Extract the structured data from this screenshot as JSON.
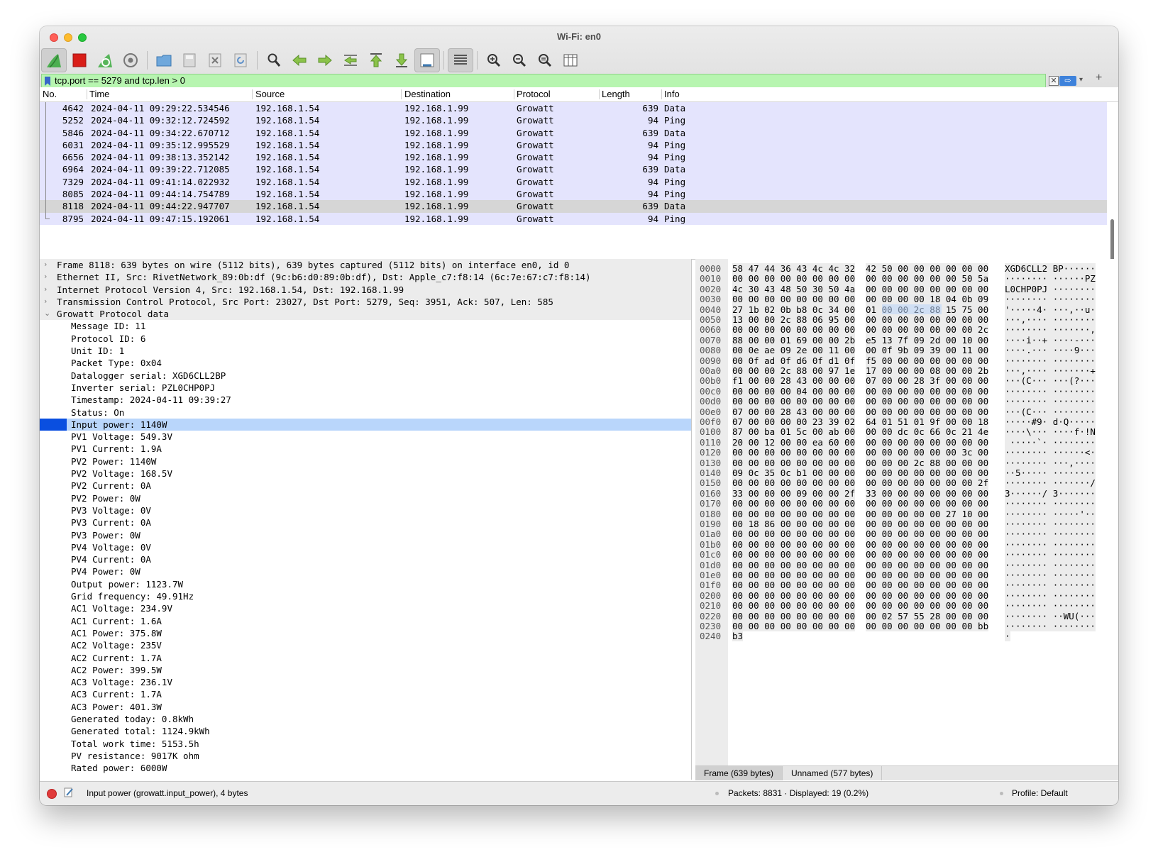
{
  "window": {
    "title": "Wi-Fi: en0"
  },
  "toolbar": {
    "icons": [
      "shark-fin-start-icon",
      "stop-capture-icon",
      "restart-capture-icon",
      "capture-options-icon",
      "open-file-icon",
      "save-file-icon",
      "close-file-icon",
      "reload-icon",
      "find-packet-icon",
      "go-back-icon",
      "go-forward-icon",
      "go-to-packet-icon",
      "first-packet-icon",
      "last-packet-icon",
      "autoscroll-icon",
      "colorize-icon",
      "zoom-in-icon",
      "zoom-out-icon",
      "normal-size-icon",
      "resize-columns-icon"
    ]
  },
  "filter": {
    "value": "tcp.port == 5279 and tcp.len > 0",
    "clear": "✕",
    "apply": "⇨",
    "dropdown": "▾",
    "add": "+"
  },
  "packet_list": {
    "columns": [
      "No.",
      "Time",
      "Source",
      "Destination",
      "Protocol",
      "Length",
      "Info"
    ],
    "rows": [
      {
        "no": "4642",
        "time": "2024-04-11 09:29:22.534546",
        "src": "192.168.1.54",
        "dst": "192.168.1.99",
        "proto": "Growatt",
        "len": "639",
        "info": "Data"
      },
      {
        "no": "5252",
        "time": "2024-04-11 09:32:12.724592",
        "src": "192.168.1.54",
        "dst": "192.168.1.99",
        "proto": "Growatt",
        "len": "94",
        "info": "Ping"
      },
      {
        "no": "5846",
        "time": "2024-04-11 09:34:22.670712",
        "src": "192.168.1.54",
        "dst": "192.168.1.99",
        "proto": "Growatt",
        "len": "639",
        "info": "Data"
      },
      {
        "no": "6031",
        "time": "2024-04-11 09:35:12.995529",
        "src": "192.168.1.54",
        "dst": "192.168.1.99",
        "proto": "Growatt",
        "len": "94",
        "info": "Ping"
      },
      {
        "no": "6656",
        "time": "2024-04-11 09:38:13.352142",
        "src": "192.168.1.54",
        "dst": "192.168.1.99",
        "proto": "Growatt",
        "len": "94",
        "info": "Ping"
      },
      {
        "no": "6964",
        "time": "2024-04-11 09:39:22.712085",
        "src": "192.168.1.54",
        "dst": "192.168.1.99",
        "proto": "Growatt",
        "len": "639",
        "info": "Data"
      },
      {
        "no": "7329",
        "time": "2024-04-11 09:41:14.022932",
        "src": "192.168.1.54",
        "dst": "192.168.1.99",
        "proto": "Growatt",
        "len": "94",
        "info": "Ping"
      },
      {
        "no": "8085",
        "time": "2024-04-11 09:44:14.754789",
        "src": "192.168.1.54",
        "dst": "192.168.1.99",
        "proto": "Growatt",
        "len": "94",
        "info": "Ping"
      },
      {
        "no": "8118",
        "time": "2024-04-11 09:44:22.947707",
        "src": "192.168.1.54",
        "dst": "192.168.1.99",
        "proto": "Growatt",
        "len": "639",
        "info": "Data"
      },
      {
        "no": "8795",
        "time": "2024-04-11 09:47:15.192061",
        "src": "192.168.1.54",
        "dst": "192.168.1.99",
        "proto": "Growatt",
        "len": "94",
        "info": "Ping"
      }
    ],
    "selected_index": 8
  },
  "details": {
    "top": [
      {
        "text": "Frame 8118: 639 bytes on wire (5112 bits), 639 bytes captured (5112 bits) on interface en0, id 0",
        "arrow": "›"
      },
      {
        "text": "Ethernet II, Src: RivetNetwork_89:0b:df (9c:b6:d0:89:0b:df), Dst: Apple_c7:f8:14 (6c:7e:67:c7:f8:14)",
        "arrow": "›"
      },
      {
        "text": "Internet Protocol Version 4, Src: 192.168.1.54, Dst: 192.168.1.99",
        "arrow": "›"
      },
      {
        "text": "Transmission Control Protocol, Src Port: 23027, Dst Port: 5279, Seq: 3951, Ack: 507, Len: 585",
        "arrow": "›"
      },
      {
        "text": "Growatt Protocol data",
        "arrow": "⌄"
      }
    ],
    "fields": [
      "Message ID: 11",
      "Protocol ID: 6",
      "Unit ID: 1",
      "Packet Type: 0x04",
      "Datalogger serial: XGD6CLL2BP",
      "Inverter serial: PZL0CHP0PJ",
      "Timestamp: 2024-04-11 09:39:27",
      "Status: On",
      "Input power: 1140W",
      "PV1 Voltage: 549.3V",
      "PV1 Current: 1.9A",
      "PV2 Power: 1140W",
      "PV2 Voltage: 168.5V",
      "PV2 Current: 0A",
      "PV2 Power: 0W",
      "PV3 Voltage: 0V",
      "PV3 Current: 0A",
      "PV3 Power: 0W",
      "PV4 Voltage: 0V",
      "PV4 Current: 0A",
      "PV4 Power: 0W",
      "Output power: 1123.7W",
      "Grid frequency: 49.91Hz",
      "AC1 Voltage: 234.9V",
      "AC1 Current: 1.6A",
      "AC1 Power: 375.8W",
      "AC2 Voltage: 235V",
      "AC2 Current: 1.7A",
      "AC2 Power: 399.5W",
      "AC3 Voltage: 236.1V",
      "AC3 Current: 1.7A",
      "AC3 Power: 401.3W",
      "Generated today: 0.8kWh",
      "Generated total: 1124.9kWh",
      "Total work time: 5153.5h",
      "PV resistance: 9017K ohm",
      "Rated power: 6000W"
    ],
    "highlighted_index": 8
  },
  "hex": {
    "rows": [
      {
        "off": "0000",
        "b1": "58 47 44 36 43 4c 4c 32",
        "b2": "42 50 00 00 00 00 00 00",
        "asc": "XGD6CLL2 BP······"
      },
      {
        "off": "0010",
        "b1": "00 00 00 00 00 00 00 00",
        "b2": "00 00 00 00 00 00 50 5a",
        "asc": "········ ······PZ"
      },
      {
        "off": "0020",
        "b1": "4c 30 43 48 50 30 50 4a",
        "b2": "00 00 00 00 00 00 00 00",
        "asc": "L0CHP0PJ ········"
      },
      {
        "off": "0030",
        "b1": "00 00 00 00 00 00 00 00",
        "b2": "00 00 00 00 18 04 0b 09",
        "asc": "········ ········"
      },
      {
        "off": "0040",
        "b1": "27 1b 02 0b b8 0c 34 00",
        "b2": "01 00 00 2c 88 15 75 00",
        "asc": "'·····4· ···,··u·",
        "hl": true
      },
      {
        "off": "0050",
        "b1": "13 00 00 2c 88 06 95 00",
        "b2": "00 00 00 00 00 00 00 00",
        "asc": "···,···· ········"
      },
      {
        "off": "0060",
        "b1": "00 00 00 00 00 00 00 00",
        "b2": "00 00 00 00 00 00 00 2c",
        "asc": "········ ·······,"
      },
      {
        "off": "0070",
        "b1": "88 00 00 01 69 00 00 2b",
        "b2": "e5 13 7f 09 2d 00 10 00",
        "asc": "····i··+ ····-···"
      },
      {
        "off": "0080",
        "b1": "00 0e ae 09 2e 00 11 00",
        "b2": "00 0f 9b 09 39 00 11 00",
        "asc": "····.··· ····9···"
      },
      {
        "off": "0090",
        "b1": "00 0f ad 0f d6 0f d1 0f",
        "b2": "f5 00 00 00 00 00 00 00",
        "asc": "········ ········"
      },
      {
        "off": "00a0",
        "b1": "00 00 00 2c 88 00 97 1e",
        "b2": "17 00 00 00 08 00 00 2b",
        "asc": "···,···· ·······+"
      },
      {
        "off": "00b0",
        "b1": "f1 00 00 28 43 00 00 00",
        "b2": "07 00 00 28 3f 00 00 00",
        "asc": "···(C··· ···(?···"
      },
      {
        "off": "00c0",
        "b1": "00 00 00 00 04 00 00 00",
        "b2": "00 00 00 00 00 00 00 00",
        "asc": "········ ········"
      },
      {
        "off": "00d0",
        "b1": "00 00 00 00 00 00 00 00",
        "b2": "00 00 00 00 00 00 00 00",
        "asc": "········ ········"
      },
      {
        "off": "00e0",
        "b1": "07 00 00 28 43 00 00 00",
        "b2": "00 00 00 00 00 00 00 00",
        "asc": "···(C··· ········"
      },
      {
        "off": "00f0",
        "b1": "07 00 00 00 00 23 39 02",
        "b2": "64 01 51 01 9f 00 00 18",
        "asc": "·····#9· d·Q·····"
      },
      {
        "off": "0100",
        "b1": "87 00 ba 01 5c 00 ab 00",
        "b2": "00 00 dc 0c 66 0c 21 4e",
        "asc": "····\\··· ····f·!N"
      },
      {
        "off": "0110",
        "b1": "20 00 12 00 00 ea 60 00",
        "b2": "00 00 00 00 00 00 00 00",
        "asc": " ·····`· ········"
      },
      {
        "off": "0120",
        "b1": "00 00 00 00 00 00 00 00",
        "b2": "00 00 00 00 00 00 3c 00",
        "asc": "········ ······<·"
      },
      {
        "off": "0130",
        "b1": "00 00 00 00 00 00 00 00",
        "b2": "00 00 00 2c 88 00 00 00",
        "asc": "········ ···,····"
      },
      {
        "off": "0140",
        "b1": "09 0c 35 0c b1 00 00 00",
        "b2": "00 00 00 00 00 00 00 00",
        "asc": "··5····· ········"
      },
      {
        "off": "0150",
        "b1": "00 00 00 00 00 00 00 00",
        "b2": "00 00 00 00 00 00 00 2f",
        "asc": "········ ·······/"
      },
      {
        "off": "0160",
        "b1": "33 00 00 00 09 00 00 2f",
        "b2": "33 00 00 00 00 00 00 00",
        "asc": "3······/ 3·······"
      },
      {
        "off": "0170",
        "b1": "00 00 00 00 00 00 00 00",
        "b2": "00 00 00 00 00 00 00 00",
        "asc": "········ ········"
      },
      {
        "off": "0180",
        "b1": "00 00 00 00 00 00 00 00",
        "b2": "00 00 00 00 00 27 10 00",
        "asc": "········ ·····'··"
      },
      {
        "off": "0190",
        "b1": "00 18 86 00 00 00 00 00",
        "b2": "00 00 00 00 00 00 00 00",
        "asc": "········ ········"
      },
      {
        "off": "01a0",
        "b1": "00 00 00 00 00 00 00 00",
        "b2": "00 00 00 00 00 00 00 00",
        "asc": "········ ········"
      },
      {
        "off": "01b0",
        "b1": "00 00 00 00 00 00 00 00",
        "b2": "00 00 00 00 00 00 00 00",
        "asc": "········ ········"
      },
      {
        "off": "01c0",
        "b1": "00 00 00 00 00 00 00 00",
        "b2": "00 00 00 00 00 00 00 00",
        "asc": "········ ········"
      },
      {
        "off": "01d0",
        "b1": "00 00 00 00 00 00 00 00",
        "b2": "00 00 00 00 00 00 00 00",
        "asc": "········ ········"
      },
      {
        "off": "01e0",
        "b1": "00 00 00 00 00 00 00 00",
        "b2": "00 00 00 00 00 00 00 00",
        "asc": "········ ········"
      },
      {
        "off": "01f0",
        "b1": "00 00 00 00 00 00 00 00",
        "b2": "00 00 00 00 00 00 00 00",
        "asc": "········ ········"
      },
      {
        "off": "0200",
        "b1": "00 00 00 00 00 00 00 00",
        "b2": "00 00 00 00 00 00 00 00",
        "asc": "········ ········"
      },
      {
        "off": "0210",
        "b1": "00 00 00 00 00 00 00 00",
        "b2": "00 00 00 00 00 00 00 00",
        "asc": "········ ········"
      },
      {
        "off": "0220",
        "b1": "00 00 00 00 00 00 00 00",
        "b2": "00 02 57 55 28 00 00 00",
        "asc": "········ ··WU(···"
      },
      {
        "off": "0230",
        "b1": "00 00 00 00 00 00 00 00",
        "b2": "00 00 00 00 00 00 00 bb",
        "asc": "········ ········"
      },
      {
        "off": "0240",
        "b1": "b3",
        "b2": "",
        "asc": "·"
      }
    ],
    "tabs": [
      "Frame (639 bytes)",
      "Unnamed (577 bytes)"
    ]
  },
  "status": {
    "field": "Input power (growatt.input_power), 4 bytes",
    "packets": "Packets: 8831 · Displayed: 19 (0.2%)",
    "profile": "Profile: Default"
  }
}
